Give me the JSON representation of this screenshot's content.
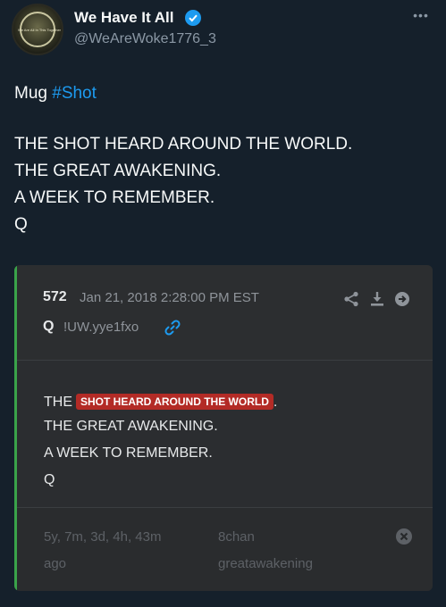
{
  "author": {
    "name": "We Have It All",
    "handle": "@WeAreWoke1776_3",
    "avatar_text": "We Are All In This Together",
    "verified_icon": "verified-badge-icon"
  },
  "tweet": {
    "text_prefix": "Mug ",
    "hashtag": "#Shot",
    "lines": [
      "THE SHOT HEARD AROUND THE WORLD.",
      "THE GREAT AWAKENING.",
      "A WEEK TO REMEMBER.",
      "Q"
    ]
  },
  "embedded_post": {
    "post_number": "572",
    "date": "Jan 21, 2018 2:28:00 PM EST",
    "poster": "Q",
    "tripcode": "!UW.yye1fxo",
    "body": {
      "prefix": "THE",
      "highlight": "SHOT HEARD AROUND THE WORLD",
      "suffix": ".",
      "lines": [
        "THE GREAT AWAKENING.",
        "A WEEK TO REMEMBER.",
        "Q"
      ]
    },
    "footer": {
      "age_line1": "5y, 7m, 3d, 4h, 43m",
      "age_line2": "ago",
      "board_line1": "8chan",
      "board_line2": "greatawakening"
    },
    "colors": {
      "accent_bar": "#3aa34a",
      "highlight_bg": "#b32b26",
      "link": "#1d9bf0"
    }
  },
  "colors": {
    "background": "#15202b",
    "hashtag": "#1d9bf0",
    "secondary_text": "#8b98a5"
  }
}
